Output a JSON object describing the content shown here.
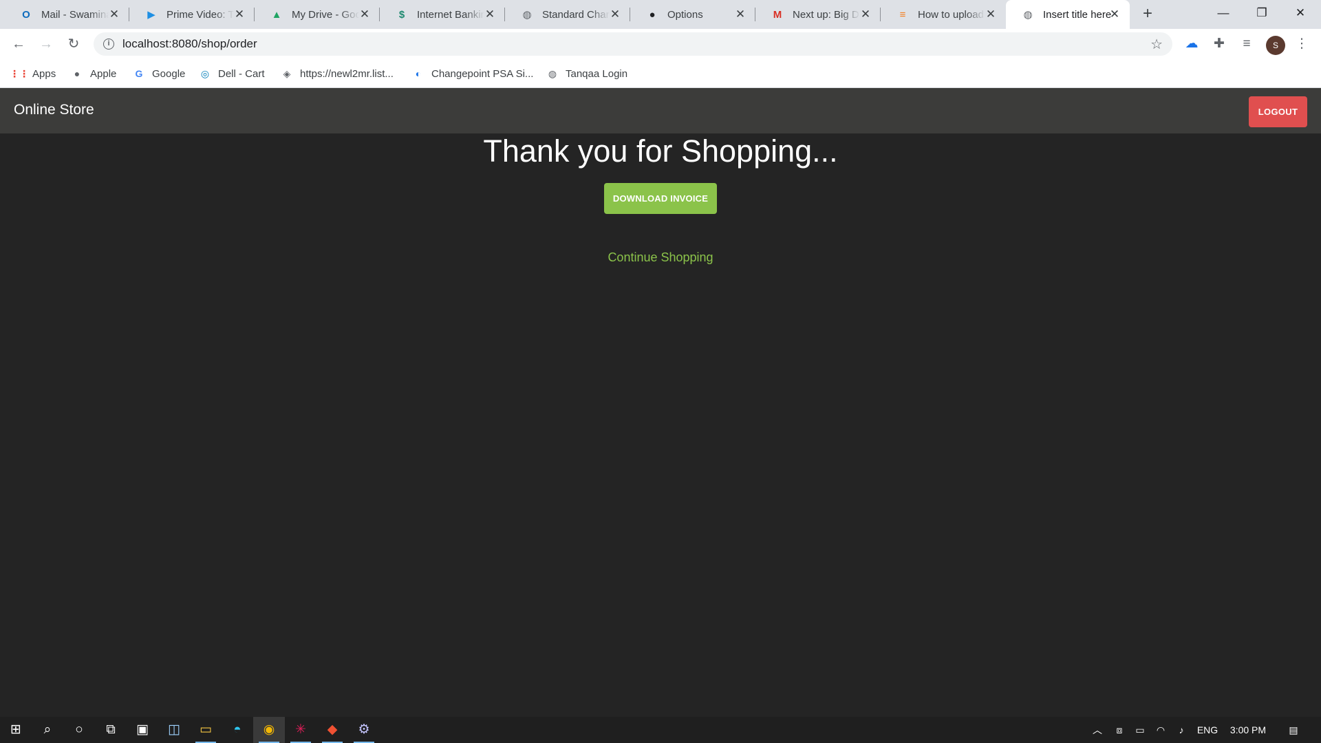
{
  "browser": {
    "tabs": [
      {
        "title": "Mail - Swaminathan",
        "icon": "outlook-icon",
        "glyph": "O",
        "color": "#0f6cbd"
      },
      {
        "title": "Prime Video: The",
        "icon": "prime-video-icon",
        "glyph": "▶",
        "color": "#1f8fe3"
      },
      {
        "title": "My Drive - Google",
        "icon": "google-drive-icon",
        "glyph": "▲",
        "color": "#1fa463"
      },
      {
        "title": "Internet Banking",
        "icon": "bank-icon",
        "glyph": "$",
        "color": "#1f8a70"
      },
      {
        "title": "Standard Chartered",
        "icon": "globe-icon",
        "glyph": "◍",
        "color": "#5f6368"
      },
      {
        "title": "Options",
        "icon": "github-icon",
        "glyph": "●",
        "color": "#202124"
      },
      {
        "title": "Next up: Big Data",
        "icon": "gmail-icon",
        "glyph": "M",
        "color": "#d93025"
      },
      {
        "title": "How to upload",
        "icon": "stackoverflow-icon",
        "glyph": "≡",
        "color": "#f48024"
      },
      {
        "title": "Insert title here",
        "icon": "globe-icon",
        "glyph": "◍",
        "color": "#5f6368",
        "active": true
      }
    ],
    "new_tab_label": "+",
    "window_controls": {
      "minimize": "—",
      "maximize": "❐",
      "close": "✕"
    },
    "address": {
      "url": "localhost:8080/shop/order"
    },
    "profile_initial": "S",
    "bookmarks": [
      {
        "label": "Apps",
        "icon": "apps-grid-icon",
        "glyph": "⋮⋮",
        "color": "#ea4335"
      },
      {
        "label": "Apple",
        "icon": "apple-icon",
        "glyph": "●",
        "color": "#5f6368"
      },
      {
        "label": "Google",
        "icon": "google-icon",
        "glyph": "G",
        "color": "#4285f4"
      },
      {
        "label": "Dell - Cart",
        "icon": "dell-icon",
        "glyph": "◎",
        "color": "#007db8"
      },
      {
        "label": "https://newl2mr.list...",
        "icon": "site-icon",
        "glyph": "◈",
        "color": "#5f6368"
      },
      {
        "label": "Changepoint PSA Si...",
        "icon": "changepoint-icon",
        "glyph": "◐",
        "color": "#1a73e8"
      },
      {
        "label": "Tanqaa Login",
        "icon": "globe-icon",
        "glyph": "◍",
        "color": "#5f6368"
      }
    ]
  },
  "app": {
    "brand": "Online Store",
    "logout_label": "LOGOUT",
    "heading": "Thank you for Shopping...",
    "download_label": "DOWNLOAD INVOICE",
    "continue_label": "Continue Shopping"
  },
  "taskbar": {
    "language": "ENG",
    "time": "3:00 PM"
  }
}
